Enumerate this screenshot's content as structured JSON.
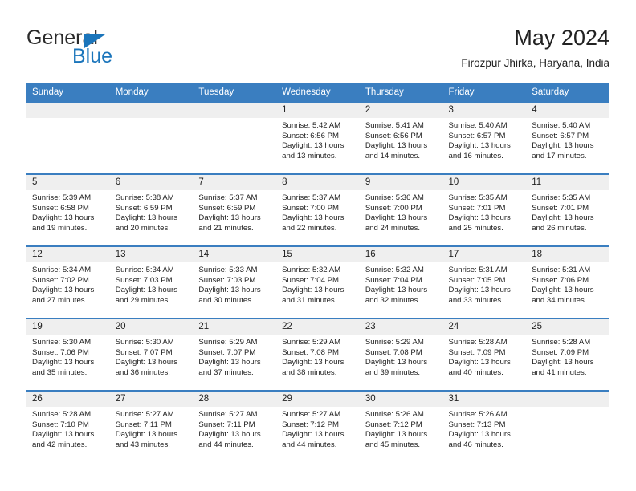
{
  "brand": {
    "name_top": "General",
    "name_bottom": "Blue",
    "triangle_color": "#1b75bb",
    "text_color": "#2b2b2b"
  },
  "header": {
    "title": "May 2024",
    "subtitle": "Firozpur Jhirka, Haryana, India"
  },
  "theme": {
    "header_bg": "#3a7ec0",
    "header_text": "#ffffff",
    "daynum_bg": "#efefef",
    "row_border": "#3a7ec0",
    "body_text": "#222222"
  },
  "weekdays": [
    "Sunday",
    "Monday",
    "Tuesday",
    "Wednesday",
    "Thursday",
    "Friday",
    "Saturday"
  ],
  "labels": {
    "sunrise": "Sunrise:",
    "sunset": "Sunset:",
    "daylight": "Daylight:"
  },
  "weeks": [
    [
      {
        "day": ""
      },
      {
        "day": ""
      },
      {
        "day": ""
      },
      {
        "day": "1",
        "sunrise": "Sunrise: 5:42 AM",
        "sunset": "Sunset: 6:56 PM",
        "daylight": "Daylight: 13 hours and 13 minutes."
      },
      {
        "day": "2",
        "sunrise": "Sunrise: 5:41 AM",
        "sunset": "Sunset: 6:56 PM",
        "daylight": "Daylight: 13 hours and 14 minutes."
      },
      {
        "day": "3",
        "sunrise": "Sunrise: 5:40 AM",
        "sunset": "Sunset: 6:57 PM",
        "daylight": "Daylight: 13 hours and 16 minutes."
      },
      {
        "day": "4",
        "sunrise": "Sunrise: 5:40 AM",
        "sunset": "Sunset: 6:57 PM",
        "daylight": "Daylight: 13 hours and 17 minutes."
      }
    ],
    [
      {
        "day": "5",
        "sunrise": "Sunrise: 5:39 AM",
        "sunset": "Sunset: 6:58 PM",
        "daylight": "Daylight: 13 hours and 19 minutes."
      },
      {
        "day": "6",
        "sunrise": "Sunrise: 5:38 AM",
        "sunset": "Sunset: 6:59 PM",
        "daylight": "Daylight: 13 hours and 20 minutes."
      },
      {
        "day": "7",
        "sunrise": "Sunrise: 5:37 AM",
        "sunset": "Sunset: 6:59 PM",
        "daylight": "Daylight: 13 hours and 21 minutes."
      },
      {
        "day": "8",
        "sunrise": "Sunrise: 5:37 AM",
        "sunset": "Sunset: 7:00 PM",
        "daylight": "Daylight: 13 hours and 22 minutes."
      },
      {
        "day": "9",
        "sunrise": "Sunrise: 5:36 AM",
        "sunset": "Sunset: 7:00 PM",
        "daylight": "Daylight: 13 hours and 24 minutes."
      },
      {
        "day": "10",
        "sunrise": "Sunrise: 5:35 AM",
        "sunset": "Sunset: 7:01 PM",
        "daylight": "Daylight: 13 hours and 25 minutes."
      },
      {
        "day": "11",
        "sunrise": "Sunrise: 5:35 AM",
        "sunset": "Sunset: 7:01 PM",
        "daylight": "Daylight: 13 hours and 26 minutes."
      }
    ],
    [
      {
        "day": "12",
        "sunrise": "Sunrise: 5:34 AM",
        "sunset": "Sunset: 7:02 PM",
        "daylight": "Daylight: 13 hours and 27 minutes."
      },
      {
        "day": "13",
        "sunrise": "Sunrise: 5:34 AM",
        "sunset": "Sunset: 7:03 PM",
        "daylight": "Daylight: 13 hours and 29 minutes."
      },
      {
        "day": "14",
        "sunrise": "Sunrise: 5:33 AM",
        "sunset": "Sunset: 7:03 PM",
        "daylight": "Daylight: 13 hours and 30 minutes."
      },
      {
        "day": "15",
        "sunrise": "Sunrise: 5:32 AM",
        "sunset": "Sunset: 7:04 PM",
        "daylight": "Daylight: 13 hours and 31 minutes."
      },
      {
        "day": "16",
        "sunrise": "Sunrise: 5:32 AM",
        "sunset": "Sunset: 7:04 PM",
        "daylight": "Daylight: 13 hours and 32 minutes."
      },
      {
        "day": "17",
        "sunrise": "Sunrise: 5:31 AM",
        "sunset": "Sunset: 7:05 PM",
        "daylight": "Daylight: 13 hours and 33 minutes."
      },
      {
        "day": "18",
        "sunrise": "Sunrise: 5:31 AM",
        "sunset": "Sunset: 7:06 PM",
        "daylight": "Daylight: 13 hours and 34 minutes."
      }
    ],
    [
      {
        "day": "19",
        "sunrise": "Sunrise: 5:30 AM",
        "sunset": "Sunset: 7:06 PM",
        "daylight": "Daylight: 13 hours and 35 minutes."
      },
      {
        "day": "20",
        "sunrise": "Sunrise: 5:30 AM",
        "sunset": "Sunset: 7:07 PM",
        "daylight": "Daylight: 13 hours and 36 minutes."
      },
      {
        "day": "21",
        "sunrise": "Sunrise: 5:29 AM",
        "sunset": "Sunset: 7:07 PM",
        "daylight": "Daylight: 13 hours and 37 minutes."
      },
      {
        "day": "22",
        "sunrise": "Sunrise: 5:29 AM",
        "sunset": "Sunset: 7:08 PM",
        "daylight": "Daylight: 13 hours and 38 minutes."
      },
      {
        "day": "23",
        "sunrise": "Sunrise: 5:29 AM",
        "sunset": "Sunset: 7:08 PM",
        "daylight": "Daylight: 13 hours and 39 minutes."
      },
      {
        "day": "24",
        "sunrise": "Sunrise: 5:28 AM",
        "sunset": "Sunset: 7:09 PM",
        "daylight": "Daylight: 13 hours and 40 minutes."
      },
      {
        "day": "25",
        "sunrise": "Sunrise: 5:28 AM",
        "sunset": "Sunset: 7:09 PM",
        "daylight": "Daylight: 13 hours and 41 minutes."
      }
    ],
    [
      {
        "day": "26",
        "sunrise": "Sunrise: 5:28 AM",
        "sunset": "Sunset: 7:10 PM",
        "daylight": "Daylight: 13 hours and 42 minutes."
      },
      {
        "day": "27",
        "sunrise": "Sunrise: 5:27 AM",
        "sunset": "Sunset: 7:11 PM",
        "daylight": "Daylight: 13 hours and 43 minutes."
      },
      {
        "day": "28",
        "sunrise": "Sunrise: 5:27 AM",
        "sunset": "Sunset: 7:11 PM",
        "daylight": "Daylight: 13 hours and 44 minutes."
      },
      {
        "day": "29",
        "sunrise": "Sunrise: 5:27 AM",
        "sunset": "Sunset: 7:12 PM",
        "daylight": "Daylight: 13 hours and 44 minutes."
      },
      {
        "day": "30",
        "sunrise": "Sunrise: 5:26 AM",
        "sunset": "Sunset: 7:12 PM",
        "daylight": "Daylight: 13 hours and 45 minutes."
      },
      {
        "day": "31",
        "sunrise": "Sunrise: 5:26 AM",
        "sunset": "Sunset: 7:13 PM",
        "daylight": "Daylight: 13 hours and 46 minutes."
      },
      {
        "day": ""
      }
    ]
  ]
}
